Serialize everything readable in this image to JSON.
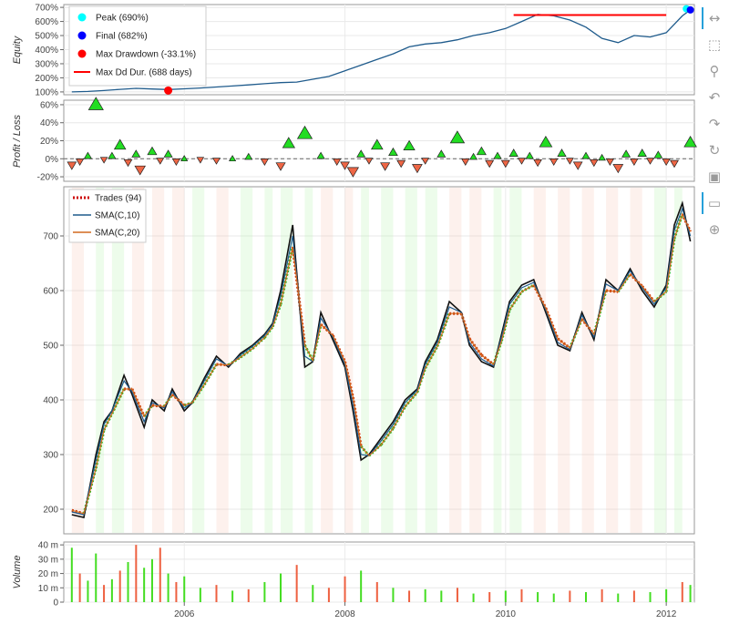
{
  "chart_data": [
    {
      "type": "line",
      "panel": "equity",
      "ylabel": "Equity",
      "y_ticks": [
        "100%",
        "200%",
        "300%",
        "400%",
        "500%",
        "600%",
        "700%"
      ],
      "ylim": [
        80,
        720
      ],
      "legend": [
        {
          "label": "Peak (690%)",
          "color": "#00ffff",
          "kind": "dot"
        },
        {
          "label": "Final (682%)",
          "color": "#0000ff",
          "kind": "dot"
        },
        {
          "label": "Max Drawdown (-33.1%)",
          "color": "#ff0000",
          "kind": "dot"
        },
        {
          "label": "Max Dd Dur. (688 days)",
          "color": "#ff0000",
          "kind": "line"
        }
      ],
      "series": [
        {
          "color": "#1f5b8c",
          "x": [
            2004.6,
            2004.8,
            2005.0,
            2005.2,
            2005.4,
            2005.6,
            2005.8,
            2006.0,
            2006.2,
            2006.4,
            2006.6,
            2006.8,
            2007.0,
            2007.2,
            2007.4,
            2007.6,
            2007.8,
            2008.0,
            2008.2,
            2008.4,
            2008.6,
            2008.8,
            2009.0,
            2009.2,
            2009.4,
            2009.6,
            2009.8,
            2010.0,
            2010.2,
            2010.4,
            2010.6,
            2010.8,
            2011.0,
            2011.2,
            2011.4,
            2011.6,
            2011.8,
            2012.0,
            2012.2,
            2012.3
          ],
          "values": [
            100,
            103,
            110,
            118,
            125,
            121,
            117,
            122,
            128,
            135,
            142,
            150,
            158,
            166,
            170,
            190,
            210,
            250,
            290,
            330,
            370,
            420,
            440,
            450,
            470,
            500,
            520,
            550,
            600,
            650,
            640,
            610,
            560,
            480,
            450,
            500,
            490,
            520,
            640,
            682
          ]
        }
      ],
      "max_dd_duration": {
        "x_start": 2010.1,
        "x_end": 2012.0,
        "y": 646
      },
      "peak": {
        "x": 2012.25,
        "y": 690
      },
      "max_drawdown_point": {
        "x": 2005.8,
        "y": 110
      }
    },
    {
      "type": "scatter",
      "panel": "profit_loss",
      "ylabel": "Profit / Loss",
      "y_ticks": [
        "-20%",
        "0%",
        "20%",
        "40%",
        "60%"
      ],
      "ylim": [
        -25,
        65
      ],
      "win_color": "#22dd22",
      "loss_color": "#ee6645",
      "points": [
        {
          "x": 2004.6,
          "y": -7
        },
        {
          "x": 2004.7,
          "y": -3
        },
        {
          "x": 2004.8,
          "y": 3
        },
        {
          "x": 2004.9,
          "y": 60
        },
        {
          "x": 2005.0,
          "y": -1
        },
        {
          "x": 2005.1,
          "y": 3
        },
        {
          "x": 2005.2,
          "y": 15
        },
        {
          "x": 2005.3,
          "y": -4
        },
        {
          "x": 2005.4,
          "y": 5
        },
        {
          "x": 2005.45,
          "y": -12
        },
        {
          "x": 2005.6,
          "y": 8
        },
        {
          "x": 2005.7,
          "y": -2
        },
        {
          "x": 2005.8,
          "y": 5
        },
        {
          "x": 2005.9,
          "y": -3
        },
        {
          "x": 2006.0,
          "y": 0
        },
        {
          "x": 2006.2,
          "y": -1
        },
        {
          "x": 2006.4,
          "y": -2
        },
        {
          "x": 2006.6,
          "y": 0
        },
        {
          "x": 2006.8,
          "y": 2
        },
        {
          "x": 2007.0,
          "y": -3
        },
        {
          "x": 2007.2,
          "y": -8
        },
        {
          "x": 2007.3,
          "y": 17
        },
        {
          "x": 2007.5,
          "y": 28
        },
        {
          "x": 2007.7,
          "y": 3
        },
        {
          "x": 2007.9,
          "y": -3
        },
        {
          "x": 2008.0,
          "y": -7
        },
        {
          "x": 2008.1,
          "y": -14
        },
        {
          "x": 2008.2,
          "y": 5
        },
        {
          "x": 2008.3,
          "y": -2
        },
        {
          "x": 2008.4,
          "y": 15
        },
        {
          "x": 2008.5,
          "y": -8
        },
        {
          "x": 2008.6,
          "y": 7
        },
        {
          "x": 2008.7,
          "y": -5
        },
        {
          "x": 2008.8,
          "y": 14
        },
        {
          "x": 2008.9,
          "y": -10
        },
        {
          "x": 2009.0,
          "y": -2
        },
        {
          "x": 2009.2,
          "y": 5
        },
        {
          "x": 2009.4,
          "y": 23
        },
        {
          "x": 2009.5,
          "y": -3
        },
        {
          "x": 2009.6,
          "y": 2
        },
        {
          "x": 2009.7,
          "y": 8
        },
        {
          "x": 2009.8,
          "y": -5
        },
        {
          "x": 2009.9,
          "y": 3
        },
        {
          "x": 2010.0,
          "y": -5
        },
        {
          "x": 2010.1,
          "y": 6
        },
        {
          "x": 2010.2,
          "y": -2
        },
        {
          "x": 2010.3,
          "y": 3
        },
        {
          "x": 2010.4,
          "y": -4
        },
        {
          "x": 2010.5,
          "y": 18
        },
        {
          "x": 2010.6,
          "y": -3
        },
        {
          "x": 2010.7,
          "y": 6
        },
        {
          "x": 2010.8,
          "y": -2
        },
        {
          "x": 2010.9,
          "y": -7
        },
        {
          "x": 2011.0,
          "y": 3
        },
        {
          "x": 2011.1,
          "y": -4
        },
        {
          "x": 2011.2,
          "y": 1
        },
        {
          "x": 2011.3,
          "y": -3
        },
        {
          "x": 2011.4,
          "y": -10
        },
        {
          "x": 2011.5,
          "y": 5
        },
        {
          "x": 2011.6,
          "y": -3
        },
        {
          "x": 2011.7,
          "y": 6
        },
        {
          "x": 2011.8,
          "y": -2
        },
        {
          "x": 2011.9,
          "y": 4
        },
        {
          "x": 2012.0,
          "y": -3
        },
        {
          "x": 2012.1,
          "y": -5
        },
        {
          "x": 2012.3,
          "y": 18
        }
      ]
    },
    {
      "type": "line",
      "panel": "price",
      "y_ticks": [
        "200",
        "300",
        "400",
        "500",
        "600",
        "700"
      ],
      "ylim": [
        155,
        790
      ],
      "legend": [
        {
          "label": "Trades (94)",
          "color": "#cc0000",
          "kind": "dashed"
        },
        {
          "label": "SMA(C,10)",
          "color": "#1f5b8c",
          "kind": "line"
        },
        {
          "label": "SMA(C,20)",
          "color": "#d2691e",
          "kind": "line"
        }
      ],
      "x": [
        2004.6,
        2004.75,
        2004.9,
        2005.0,
        2005.1,
        2005.25,
        2005.35,
        2005.5,
        2005.6,
        2005.75,
        2005.85,
        2006.0,
        2006.1,
        2006.25,
        2006.4,
        2006.55,
        2006.7,
        2006.85,
        2007.0,
        2007.1,
        2007.2,
        2007.35,
        2007.5,
        2007.6,
        2007.7,
        2007.85,
        2008.0,
        2008.1,
        2008.2,
        2008.3,
        2008.45,
        2008.6,
        2008.75,
        2008.9,
        2009.0,
        2009.15,
        2009.3,
        2009.45,
        2009.55,
        2009.7,
        2009.85,
        2009.95,
        2010.05,
        2010.2,
        2010.35,
        2010.5,
        2010.65,
        2010.8,
        2010.95,
        2011.1,
        2011.25,
        2011.4,
        2011.55,
        2011.7,
        2011.85,
        2012.0,
        2012.1,
        2012.2,
        2012.3
      ],
      "close": [
        190,
        185,
        300,
        360,
        380,
        445,
        410,
        350,
        400,
        380,
        420,
        380,
        395,
        440,
        480,
        460,
        485,
        500,
        520,
        540,
        600,
        720,
        460,
        470,
        560,
        510,
        460,
        380,
        290,
        300,
        330,
        360,
        400,
        420,
        470,
        510,
        580,
        560,
        500,
        470,
        460,
        520,
        580,
        610,
        620,
        560,
        500,
        490,
        560,
        510,
        620,
        600,
        640,
        600,
        570,
        610,
        720,
        760,
        690
      ],
      "sma10": [
        195,
        190,
        290,
        355,
        380,
        435,
        415,
        360,
        395,
        385,
        415,
        385,
        395,
        435,
        475,
        462,
        482,
        498,
        518,
        538,
        590,
        700,
        480,
        470,
        550,
        515,
        465,
        390,
        300,
        298,
        325,
        355,
        395,
        418,
        465,
        505,
        570,
        560,
        505,
        475,
        462,
        515,
        575,
        605,
        615,
        565,
        505,
        492,
        555,
        515,
        612,
        600,
        636,
        605,
        575,
        605,
        710,
        750,
        700
      ],
      "sma20": [
        198,
        192,
        275,
        345,
        375,
        420,
        420,
        370,
        390,
        388,
        410,
        390,
        395,
        428,
        465,
        464,
        478,
        494,
        514,
        534,
        575,
        680,
        500,
        472,
        538,
        518,
        470,
        405,
        315,
        298,
        318,
        348,
        388,
        414,
        458,
        498,
        558,
        558,
        512,
        482,
        465,
        508,
        565,
        598,
        610,
        568,
        512,
        495,
        548,
        520,
        600,
        598,
        630,
        608,
        580,
        598,
        695,
        740,
        708
      ]
    },
    {
      "type": "bar",
      "panel": "volume",
      "ylabel": "Volume",
      "y_ticks": [
        "0",
        "10 m",
        "20 m",
        "30 m",
        "40 m"
      ],
      "ylim": [
        0,
        42
      ],
      "x_ticks": [
        "2006",
        "2008",
        "2010",
        "2012"
      ],
      "up_color": "#44dd22",
      "down_color": "#ee6040",
      "x": [
        2004.6,
        2004.7,
        2004.8,
        2004.9,
        2005.0,
        2005.1,
        2005.2,
        2005.3,
        2005.4,
        2005.5,
        2005.6,
        2005.7,
        2005.8,
        2005.9,
        2006.0,
        2006.2,
        2006.4,
        2006.6,
        2006.8,
        2007.0,
        2007.2,
        2007.4,
        2007.6,
        2007.8,
        2008.0,
        2008.2,
        2008.4,
        2008.6,
        2008.8,
        2009.0,
        2009.2,
        2009.4,
        2009.6,
        2009.8,
        2010.0,
        2010.2,
        2010.4,
        2010.6,
        2010.8,
        2011.0,
        2011.2,
        2011.4,
        2011.6,
        2011.8,
        2012.0,
        2012.2,
        2012.3
      ],
      "values": [
        38,
        20,
        15,
        34,
        12,
        16,
        22,
        28,
        40,
        24,
        30,
        38,
        20,
        14,
        18,
        10,
        12,
        8,
        9,
        14,
        20,
        26,
        12,
        10,
        18,
        22,
        14,
        10,
        8,
        9,
        8,
        10,
        6,
        7,
        8,
        9,
        7,
        6,
        8,
        7,
        9,
        6,
        8,
        7,
        9,
        14,
        12
      ],
      "up": [
        true,
        false,
        true,
        true,
        false,
        true,
        false,
        true,
        false,
        true,
        true,
        false,
        true,
        false,
        true,
        true,
        false,
        true,
        false,
        true,
        true,
        false,
        true,
        false,
        false,
        true,
        false,
        true,
        false,
        true,
        true,
        false,
        true,
        false,
        true,
        false,
        true,
        true,
        false,
        true,
        false,
        true,
        false,
        true,
        true,
        false,
        true
      ]
    }
  ],
  "x_domain": [
    2004.5,
    2012.35
  ],
  "toolbar": [
    {
      "icon": "pan-icon",
      "glyph": "↔",
      "active": true
    },
    {
      "icon": "box-zoom-icon",
      "glyph": "⬚",
      "active": false
    },
    {
      "icon": "wheel-zoom-icon",
      "glyph": "⚲",
      "active": false
    },
    {
      "icon": "undo-icon",
      "glyph": "↶",
      "active": false
    },
    {
      "icon": "redo-icon",
      "glyph": "↷",
      "active": false
    },
    {
      "icon": "reset-icon",
      "glyph": "↻",
      "active": false
    },
    {
      "icon": "save-icon",
      "glyph": "▣",
      "active": false
    },
    {
      "icon": "hover-icon",
      "glyph": "▭",
      "active": true
    },
    {
      "icon": "crosshair-icon",
      "glyph": "⊕",
      "active": false
    }
  ]
}
